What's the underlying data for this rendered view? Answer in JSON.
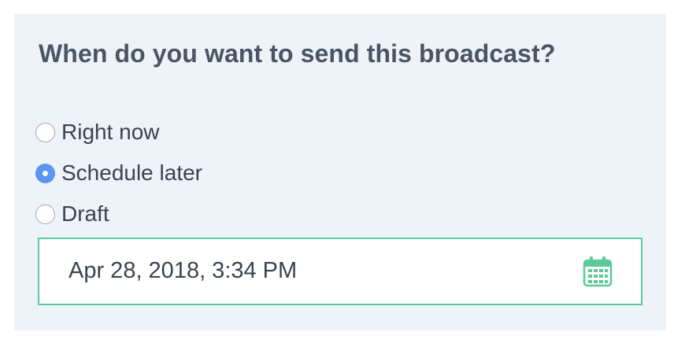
{
  "question": "When do you want to send this broadcast?",
  "options": [
    {
      "label": "Right now",
      "selected": false
    },
    {
      "label": "Schedule later",
      "selected": true
    },
    {
      "label": "Draft",
      "selected": false
    }
  ],
  "schedule": {
    "value": "Apr 28, 2018, 3:34 PM",
    "icon": "calendar-icon"
  },
  "colors": {
    "panel_bg": "#eef2f9",
    "radio_selected": "#5b95f0",
    "input_border": "#5cc99a",
    "calendar_icon": "#5cc99a",
    "text": "#3b4252"
  }
}
